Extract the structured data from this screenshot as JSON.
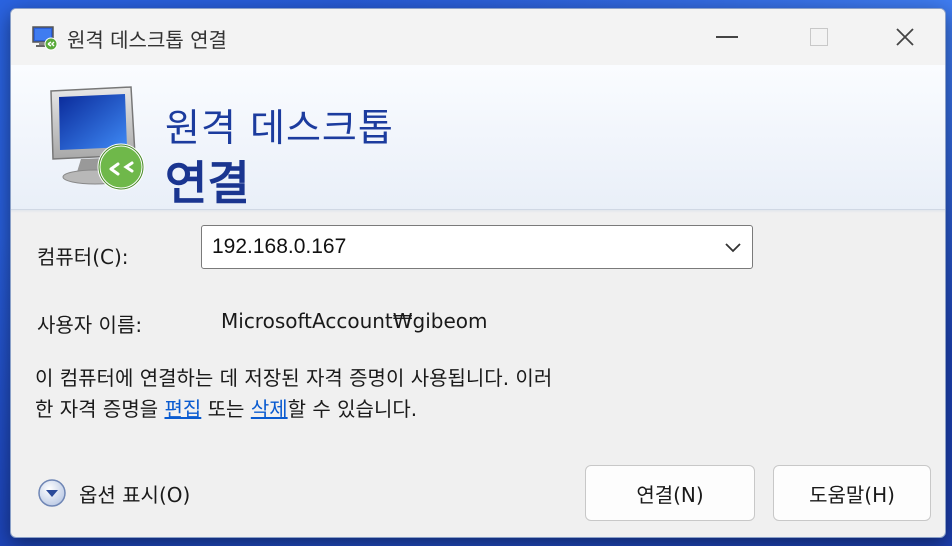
{
  "window": {
    "title": "원격 데스크톱 연결",
    "icon": "remote-desktop-icon"
  },
  "controls": {
    "minimize": "minimize-icon",
    "maximize": "maximize-icon",
    "close_glyph": "✕"
  },
  "header": {
    "line1": "원격 데스크톱",
    "line2": "연결"
  },
  "form": {
    "computer_label": "컴퓨터(C):",
    "computer_value": "192.168.0.167",
    "user_label": "사용자 이름:",
    "user_value": "MicrosoftAccount₩gibeom"
  },
  "info": {
    "text_1": "이 컴퓨터에 연결하는 데 저장된 자격 증명이 사용됩니다. 이러",
    "text_2": "한 자격 증명을 ",
    "link_edit": "편집",
    "text_3": " 또는 ",
    "link_delete": "삭제",
    "text_4": "할 수 있습니다."
  },
  "options": {
    "label": "옵션 표시(O)"
  },
  "buttons": {
    "connect": "연결(N)",
    "help": "도움말(H)"
  },
  "colors": {
    "accent": "#1c3c9e",
    "link": "#0a5bd0"
  }
}
